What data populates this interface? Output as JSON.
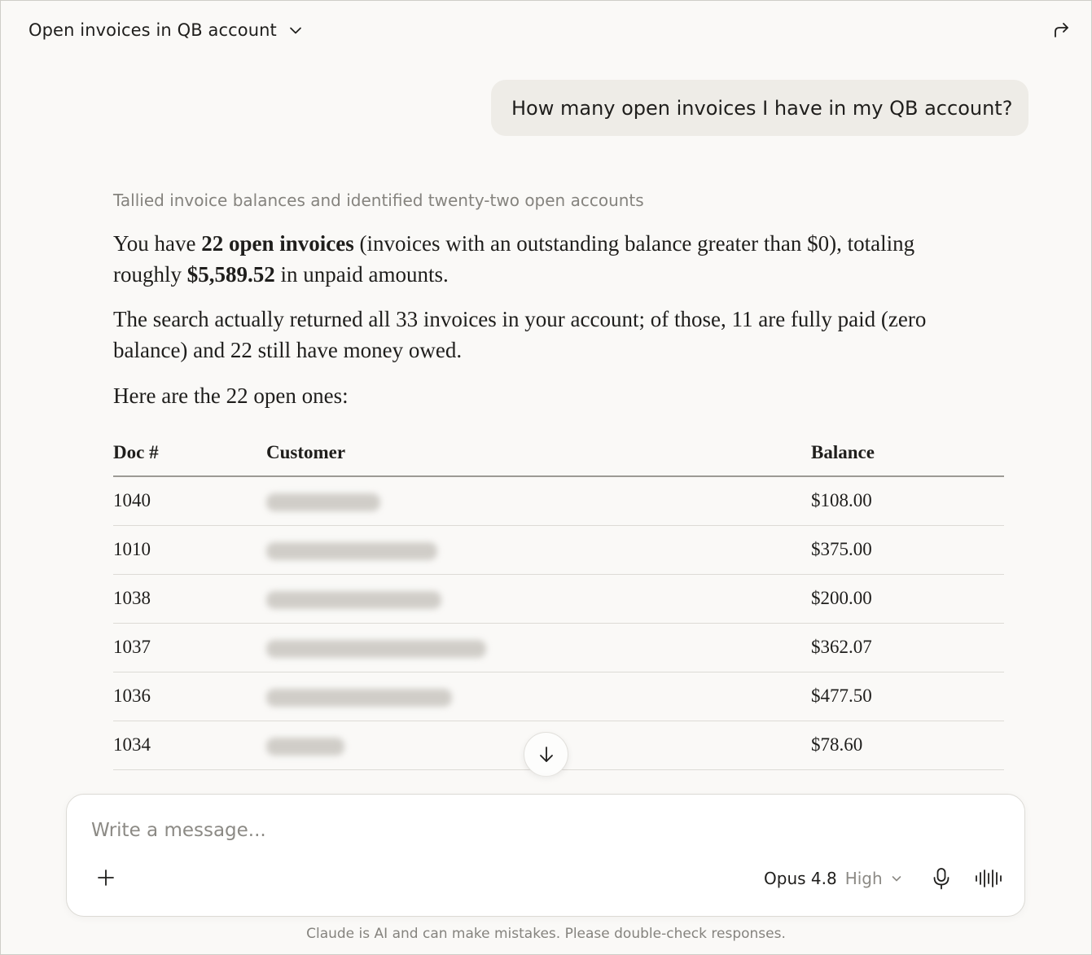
{
  "header": {
    "chat_title": "Open invoices in QB account",
    "icons": [
      "chevron-down-icon",
      "share-icon"
    ]
  },
  "conversation": {
    "user_message": "How many open invoices I have in my QB account?",
    "thinking_summary": "Tallied invoice balances and identified twenty-two open accounts",
    "response": {
      "p1_a": "You have ",
      "p1_b": "22 open invoices",
      "p1_c": " (invoices with an outstanding balance greater than $0), totaling roughly ",
      "p1_d": "$5,589.52",
      "p1_e": " in unpaid amounts.",
      "p2": "The search actually returned all 33 invoices in your account; of those, 11 are fully paid (zero balance) and 22 still have money owed.",
      "p3": "Here are the 22 open ones:"
    },
    "table": {
      "headers": {
        "doc": "Doc #",
        "customer": "Customer",
        "balance": "Balance"
      },
      "rows": [
        {
          "doc": "1040",
          "balance": "$108.00"
        },
        {
          "doc": "1010",
          "balance": "$375.00"
        },
        {
          "doc": "1038",
          "balance": "$200.00"
        },
        {
          "doc": "1037",
          "balance": "$362.07"
        },
        {
          "doc": "1036",
          "balance": "$477.50"
        },
        {
          "doc": "1034",
          "balance": "$78.60"
        }
      ]
    }
  },
  "composer": {
    "placeholder": "Write a message...",
    "model": "Opus 4.8",
    "effort": "High",
    "icons": [
      "plus-icon",
      "microphone-icon",
      "voice-mode-icon",
      "chevron-down-icon",
      "arrow-down-icon"
    ]
  },
  "footer": {
    "disclaimer": "Claude is AI and can make mistakes. Please double-check responses."
  },
  "colors": {
    "background": "#faf9f7",
    "user_bubble": "#eeece7",
    "text": "#1f1e1c",
    "muted_text": "#85837e"
  }
}
